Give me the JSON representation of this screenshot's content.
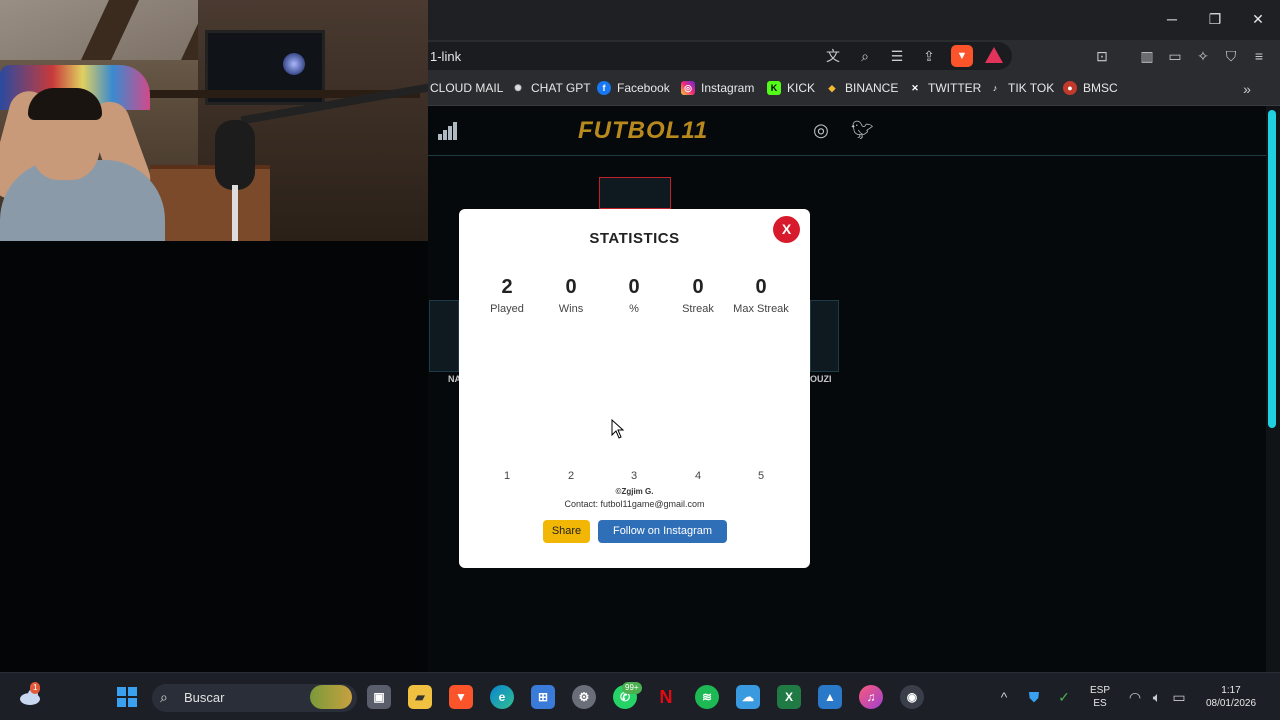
{
  "browser": {
    "url": "1-link",
    "window_controls": {
      "minimize": "─",
      "maximize": "❐",
      "close": "✕"
    },
    "bookmarks": [
      {
        "label": "CLOUD MAIL",
        "icon": "cloud-icon",
        "color": "#2b2c30"
      },
      {
        "label": "CHAT GPT",
        "icon": "chatgpt-icon",
        "color": "#ffffff"
      },
      {
        "label": "Facebook",
        "icon": "facebook-icon",
        "color": "#1877f2"
      },
      {
        "label": "Instagram",
        "icon": "instagram-icon",
        "color": "#d6249f"
      },
      {
        "label": "KICK",
        "icon": "kick-icon",
        "color": "#53fc18"
      },
      {
        "label": "BINANCE",
        "icon": "binance-icon",
        "color": "#f3ba2f"
      },
      {
        "label": "TWITTER",
        "icon": "x-icon",
        "color": "#000000"
      },
      {
        "label": "TIK TOK",
        "icon": "tiktok-icon",
        "color": "#000000"
      },
      {
        "label": "BMSC",
        "icon": "bmsc-icon",
        "color": "#c0392b"
      }
    ]
  },
  "site": {
    "logo": "FUTBOL11",
    "player_names": {
      "left": "NA",
      "right": "OUZI"
    }
  },
  "modal": {
    "title": "STATISTICS",
    "close_label": "X",
    "stats": [
      {
        "value": "2",
        "label": "Played"
      },
      {
        "value": "0",
        "label": "Wins"
      },
      {
        "value": "0",
        "label": "%"
      },
      {
        "value": "0",
        "label": "Streak"
      },
      {
        "value": "0",
        "label": "Max Streak"
      }
    ],
    "distribution_labels": [
      "1",
      "2",
      "3",
      "4",
      "5"
    ],
    "credit": "©Zgjim G.",
    "contact": "Contact: futbol11game@gmail.com",
    "share_label": "Share",
    "instagram_label": "Follow on Instagram"
  },
  "taskbar": {
    "search_placeholder": "Buscar",
    "whatsapp_badge": "99+",
    "weather_badge": "1",
    "language": {
      "top": "ESP",
      "bottom": "ES"
    },
    "time": "1:17",
    "date": "08/01/2026"
  }
}
